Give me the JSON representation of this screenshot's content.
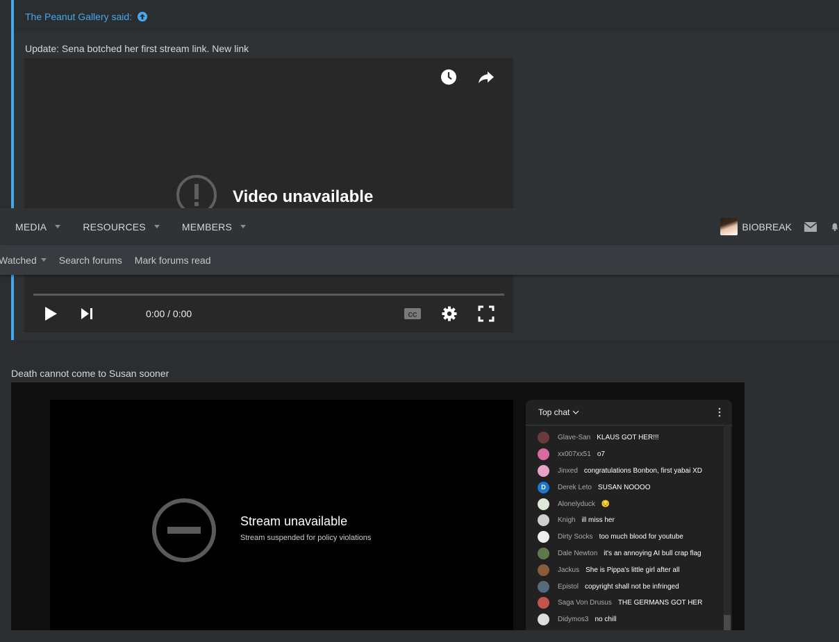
{
  "quote": {
    "author": "The Peanut Gallery said:",
    "text": "Update: Sena botched her first stream link. New link"
  },
  "video1": {
    "unavailable_text": "Video unavailable",
    "time": "0:00 / 0:00"
  },
  "nav": {
    "tabs": [
      {
        "label": "MEDIA"
      },
      {
        "label": "RESOURCES"
      },
      {
        "label": "MEMBERS"
      }
    ],
    "username": "BIOBREAK"
  },
  "subnav": {
    "items": [
      "Watched",
      "Search forums",
      "Mark forums read"
    ]
  },
  "post": {
    "text": "Death cannot come to Susan sooner"
  },
  "stream": {
    "title": "Stream unavailable",
    "subtitle": "Stream suspended for policy violations"
  },
  "chat": {
    "title": "Top chat",
    "messages": [
      {
        "name": "Glave-San",
        "msg": "KLAUS GOT HER!!!",
        "color": "#6b3a3a"
      },
      {
        "name": "xx007xx51",
        "msg": "o7",
        "color": "#d96aa0"
      },
      {
        "name": "Jinxed",
        "msg": "congratulations Bonbon, first yabai XD",
        "color": "#e7a2c6"
      },
      {
        "name": "Derek Leto",
        "msg": "SUSAN NOOOO",
        "color": "#1976d2",
        "initial": "D"
      },
      {
        "name": "Alonelyduck",
        "msg": "😔",
        "color": "#dfe8d8"
      },
      {
        "name": "Knigh",
        "msg": "ill miss her",
        "color": "#cfcfcf"
      },
      {
        "name": "Dirty Socks",
        "msg": "too much blood for youtube",
        "color": "#eeeeee"
      },
      {
        "name": "Dale Newton",
        "msg": "it's an annoying AI bull crap flag",
        "color": "#5d7a4a"
      },
      {
        "name": "Jackus",
        "msg": "She is Pippa's little girl after all",
        "color": "#8a5a3a"
      },
      {
        "name": "Epistol",
        "msg": "copyright shall not be infringed",
        "color": "#556b7a"
      },
      {
        "name": "Saga Von Drusus",
        "msg": "THE GERMANS GOT HER",
        "color": "#c0564a"
      },
      {
        "name": "Didymos3",
        "msg": "no chill",
        "color": "#dddddd"
      }
    ]
  }
}
